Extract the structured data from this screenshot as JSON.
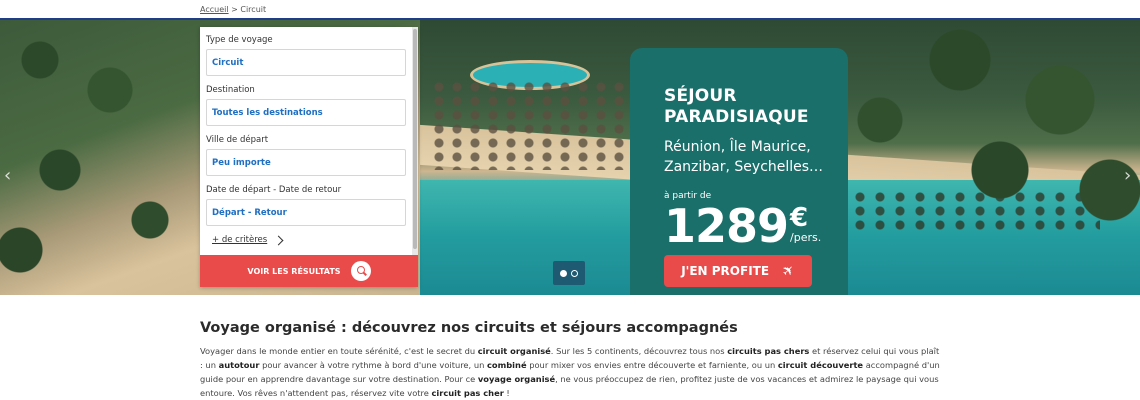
{
  "breadcrumb": {
    "home": "Accueil",
    "separator": ">",
    "current": "Circuit"
  },
  "search": {
    "fields": [
      {
        "label": "Type de voyage",
        "value": "Circuit"
      },
      {
        "label": "Destination",
        "value": "Toutes les destinations"
      },
      {
        "label": "Ville de départ",
        "value": "Peu importe"
      },
      {
        "label": "Date de départ - Date de retour",
        "value": "Départ - Retour"
      }
    ],
    "more_criteria": "+ de critères",
    "submit_label": "VOIR LES RÉSULTATS",
    "submit_icon": "search-icon"
  },
  "carousel": {
    "slides": 2,
    "active": 1
  },
  "promo": {
    "title_line1": "SÉJOUR",
    "title_line2": "PARADISIAQUE",
    "places_line1": "Réunion, Île Maurice,",
    "places_line2": "Zanzibar, Seychelles…",
    "from": "à partir de",
    "price": "1289",
    "currency": "€",
    "per": "/pers.",
    "cta": "J'EN PROFITE",
    "cta_icon": "plane-icon",
    "color": "#1b6f6b"
  },
  "content": {
    "heading": "Voyage organisé : découvrez nos circuits et séjours accompagnés",
    "p": [
      "Voyager dans le monde entier en toute sérénité, c'est le secret du ",
      "circuit organisé",
      ". Sur les 5 continents, découvrez tous nos ",
      "circuits pas chers",
      " et réservez celui qui vous plaît : un ",
      "autotour",
      " pour avancer à votre rythme à bord d'une voiture, un ",
      "combiné",
      " pour mixer vos envies entre découverte et farniente, ou un ",
      "circuit découverte",
      " accompagné d'un guide pour en apprendre davantage sur votre destination. Pour ce ",
      "voyage organisé",
      ", ne vous préoccupez de rien, profitez juste de vos vacances et admirez le paysage qui vous entoure. Vos rêves n'attendent pas, réservez vite votre ",
      "circuit pas cher",
      " !"
    ]
  },
  "colors": {
    "accent": "#e94b4b",
    "link": "#1f6fc2",
    "topline": "#1f3e8a"
  }
}
